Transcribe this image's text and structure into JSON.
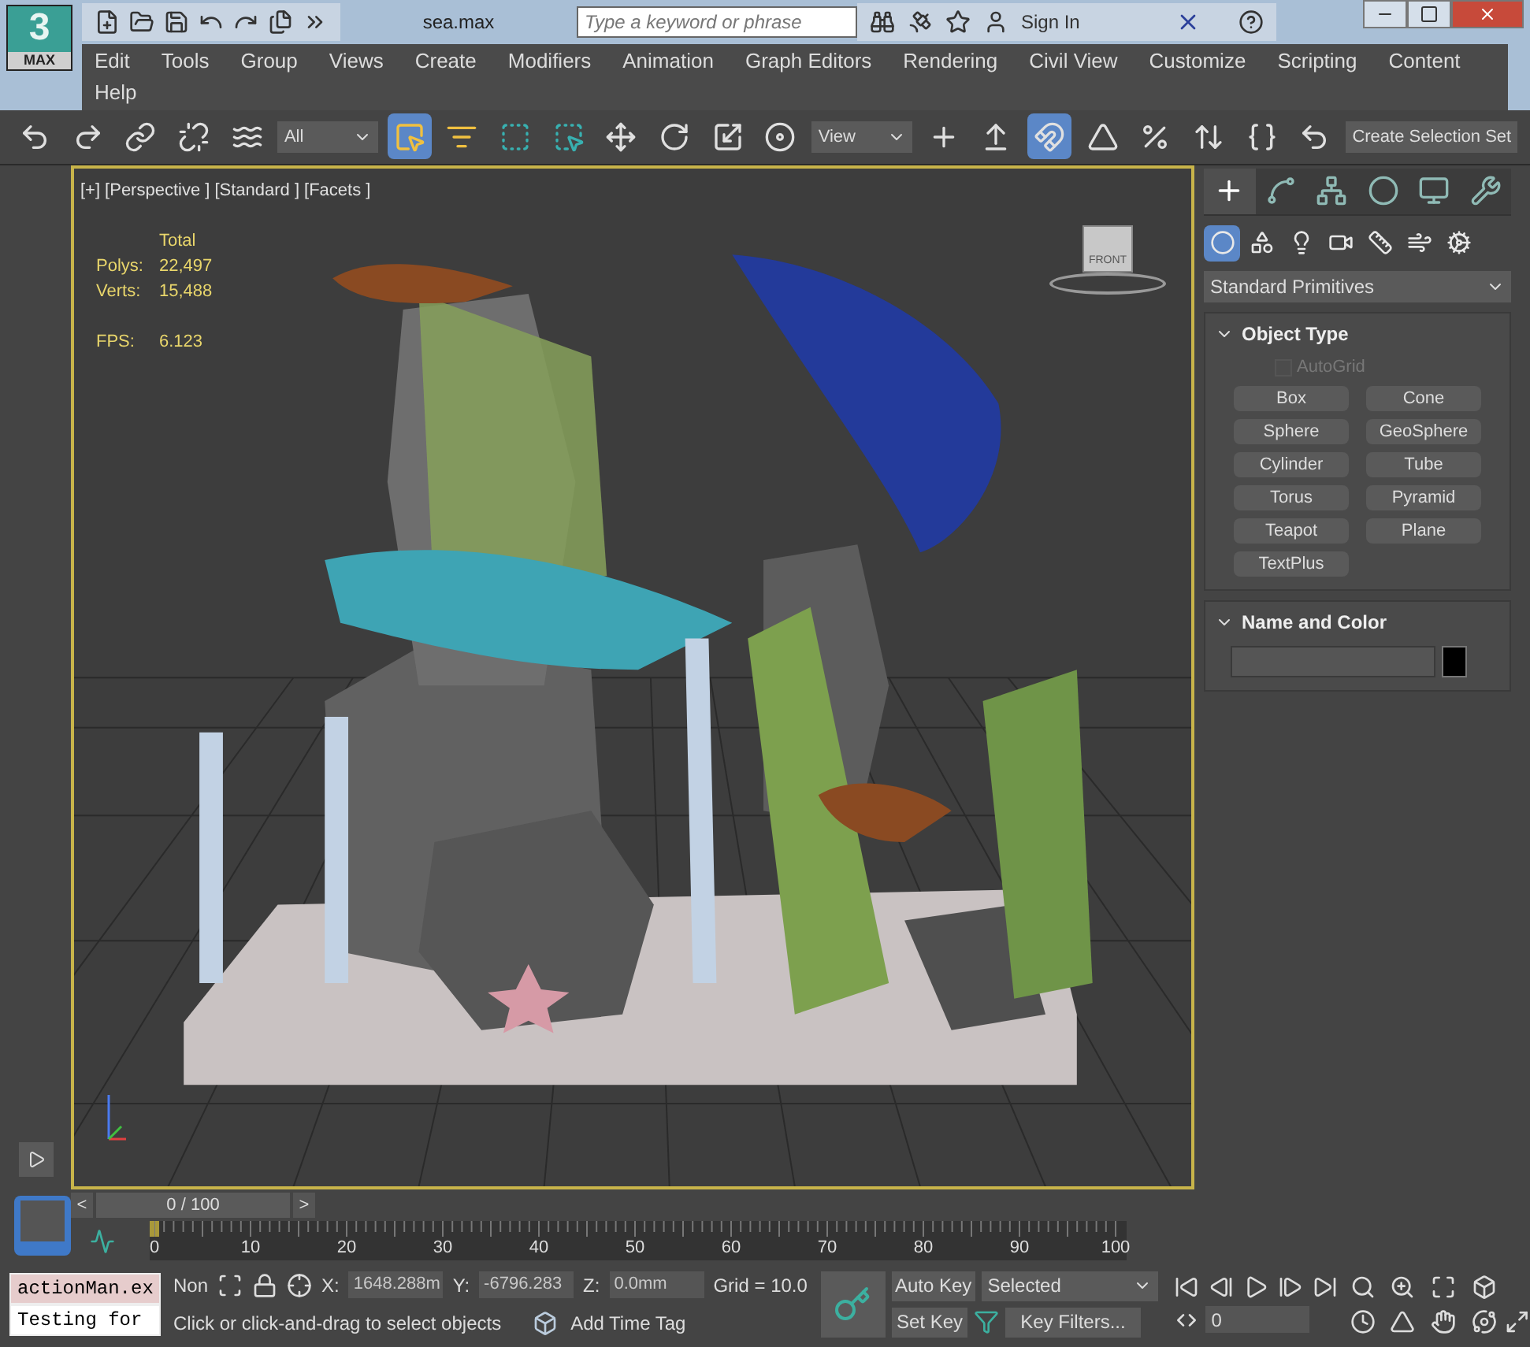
{
  "logo": {
    "mark": "3",
    "label": "MAX"
  },
  "title_bar": {
    "file_name": "sea.max",
    "search": {
      "placeholder": "Type a keyword or phrase"
    },
    "sign_in": "Sign In"
  },
  "menu": [
    "Edit",
    "Tools",
    "Group",
    "Views",
    "Create",
    "Modifiers",
    "Animation",
    "Graph Editors",
    "Rendering",
    "Civil View",
    "Customize",
    "Scripting",
    "Content",
    "Help"
  ],
  "toolbar": [
    {
      "kind": "tool",
      "selected": false
    },
    {
      "kind": "tool",
      "selected": false
    },
    {
      "kind": "tool",
      "selected": false
    },
    {
      "kind": "tool",
      "selected": false
    },
    {
      "kind": "tool",
      "selected": false
    },
    {
      "kind": "dropdown",
      "value": "All"
    },
    {
      "kind": "tool",
      "selected": true
    },
    {
      "kind": "tool",
      "selected": false
    },
    {
      "kind": "tool",
      "selected": false
    },
    {
      "kind": "tool",
      "selected": false
    },
    {
      "kind": "tool",
      "selected": false
    },
    {
      "kind": "tool",
      "selected": false
    },
    {
      "kind": "tool",
      "selected": false
    },
    {
      "kind": "tool",
      "selected": false
    },
    {
      "kind": "dropdown",
      "value": "View"
    },
    {
      "kind": "tool",
      "selected": false
    },
    {
      "kind": "tool",
      "selected": false
    },
    {
      "kind": "tool",
      "selected": true
    },
    {
      "kind": "tool",
      "selected": false
    },
    {
      "kind": "tool",
      "selected": false
    },
    {
      "kind": "tool",
      "selected": false
    },
    {
      "kind": "tool",
      "selected": false
    },
    {
      "kind": "tool",
      "selected": false
    },
    {
      "kind": "field",
      "value": "Create Selection Set"
    }
  ],
  "viewport": {
    "labels": [
      "[+]",
      "[Perspective ]",
      "[Standard ]",
      "[Facets ]"
    ],
    "stats_header": "Total",
    "stats": [
      {
        "label": "Polys:",
        "value": "22,497"
      },
      {
        "label": "Verts:",
        "value": "15,488"
      }
    ],
    "fps": {
      "label": "FPS:",
      "value": "6.123"
    },
    "viewcube": "FRONT"
  },
  "command_panel": {
    "tabs": [
      {
        "selected": true
      },
      {
        "selected": false
      },
      {
        "selected": false
      },
      {
        "selected": false
      },
      {
        "selected": false
      },
      {
        "selected": false
      }
    ],
    "categories": [
      {
        "selected": true
      },
      {
        "selected": false
      },
      {
        "selected": false
      },
      {
        "selected": false
      },
      {
        "selected": false
      },
      {
        "selected": false
      },
      {
        "selected": false
      }
    ],
    "dropdown": "Standard Primitives",
    "object_type": {
      "title": "Object Type",
      "autogrid": {
        "label": "AutoGrid",
        "checked": false,
        "disabled": true
      },
      "buttons": [
        "Box",
        "Cone",
        "Sphere",
        "GeoSphere",
        "Cylinder",
        "Tube",
        "Torus",
        "Pyramid",
        "Teapot",
        "Plane",
        "TextPlus"
      ]
    },
    "name_and_color": {
      "title": "Name and Color",
      "color": "#000000"
    }
  },
  "time_slider": {
    "prev": "<",
    "position": "0 / 100",
    "next": ">"
  },
  "track_bar": {
    "labels": [
      "0",
      "10",
      "20",
      "30",
      "40",
      "50",
      "60",
      "70",
      "80",
      "90",
      "100"
    ]
  },
  "listener": {
    "lines": [
      "actionMan.ex",
      "Testing for"
    ]
  },
  "status": {
    "selection": "Non",
    "x": {
      "label": "X:",
      "value": "1648.288m"
    },
    "y": {
      "label": "Y:",
      "value": "-6796.283"
    },
    "z": {
      "label": "Z:",
      "value": "0.0mm"
    },
    "grid": "Grid = 10.0",
    "prompt": "Click or click-and-drag to select objects",
    "time_tag": "Add Time Tag"
  },
  "keys": {
    "auto_key": "Auto Key",
    "set_key": "Set Key",
    "key_mode": "Selected",
    "key_filters": "Key Filters...",
    "frame": "0"
  }
}
